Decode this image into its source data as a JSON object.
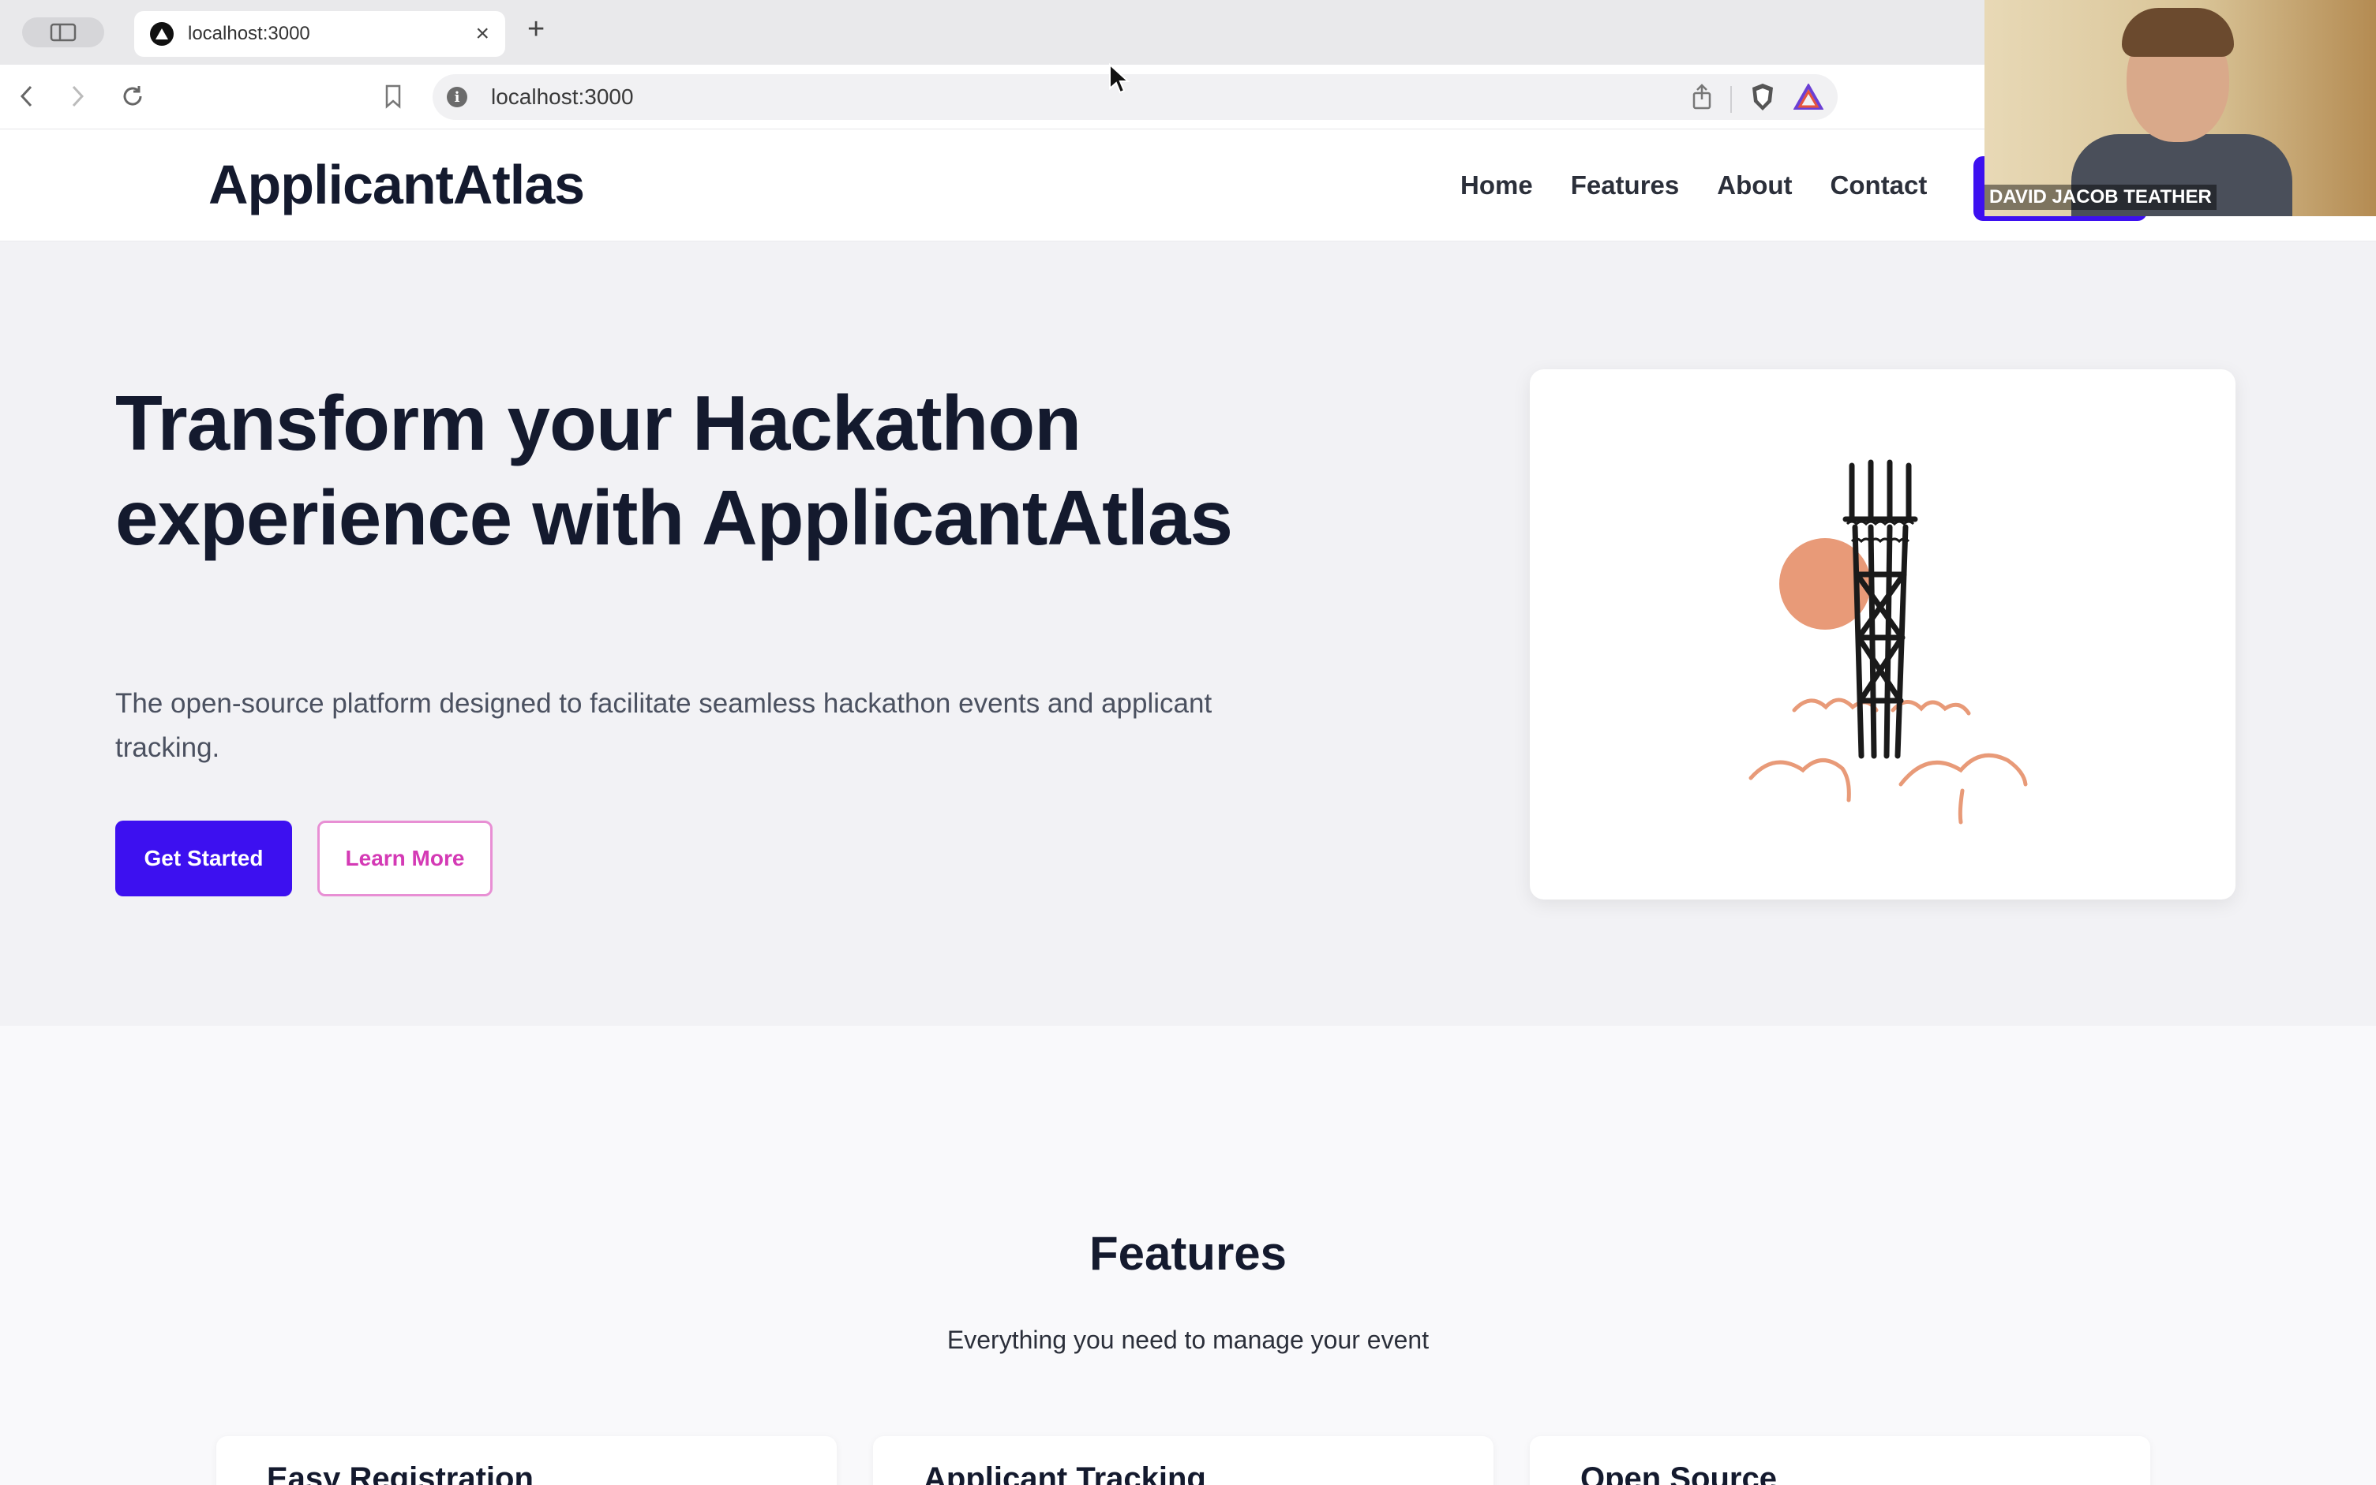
{
  "browser": {
    "tab_title": "localhost:3000",
    "tab_close": "×",
    "new_tab": "+",
    "url": "localhost:3000"
  },
  "site": {
    "logo": "ApplicantAtlas",
    "nav": [
      "Home",
      "Features",
      "About",
      "Contact"
    ]
  },
  "hero": {
    "title": "Transform your Hackathon experience with ApplicantAtlas",
    "subtitle": "The open-source platform designed to facilitate seamless hackathon events and applicant tracking.",
    "primary_button": "Get Started",
    "secondary_button": "Learn More"
  },
  "features": {
    "title": "Features",
    "subtitle": "Everything you need to manage your event",
    "cards": [
      "Easy Registration",
      "Applicant Tracking",
      "Open Source"
    ]
  },
  "webcam": {
    "name": "DAVID JACOB TEATHER"
  },
  "colors": {
    "primary": "#3d10f0",
    "outline_accent": "#d43ab5",
    "illustration_sun": "#e89a78",
    "illustration_tower": "#1a1a1a"
  }
}
